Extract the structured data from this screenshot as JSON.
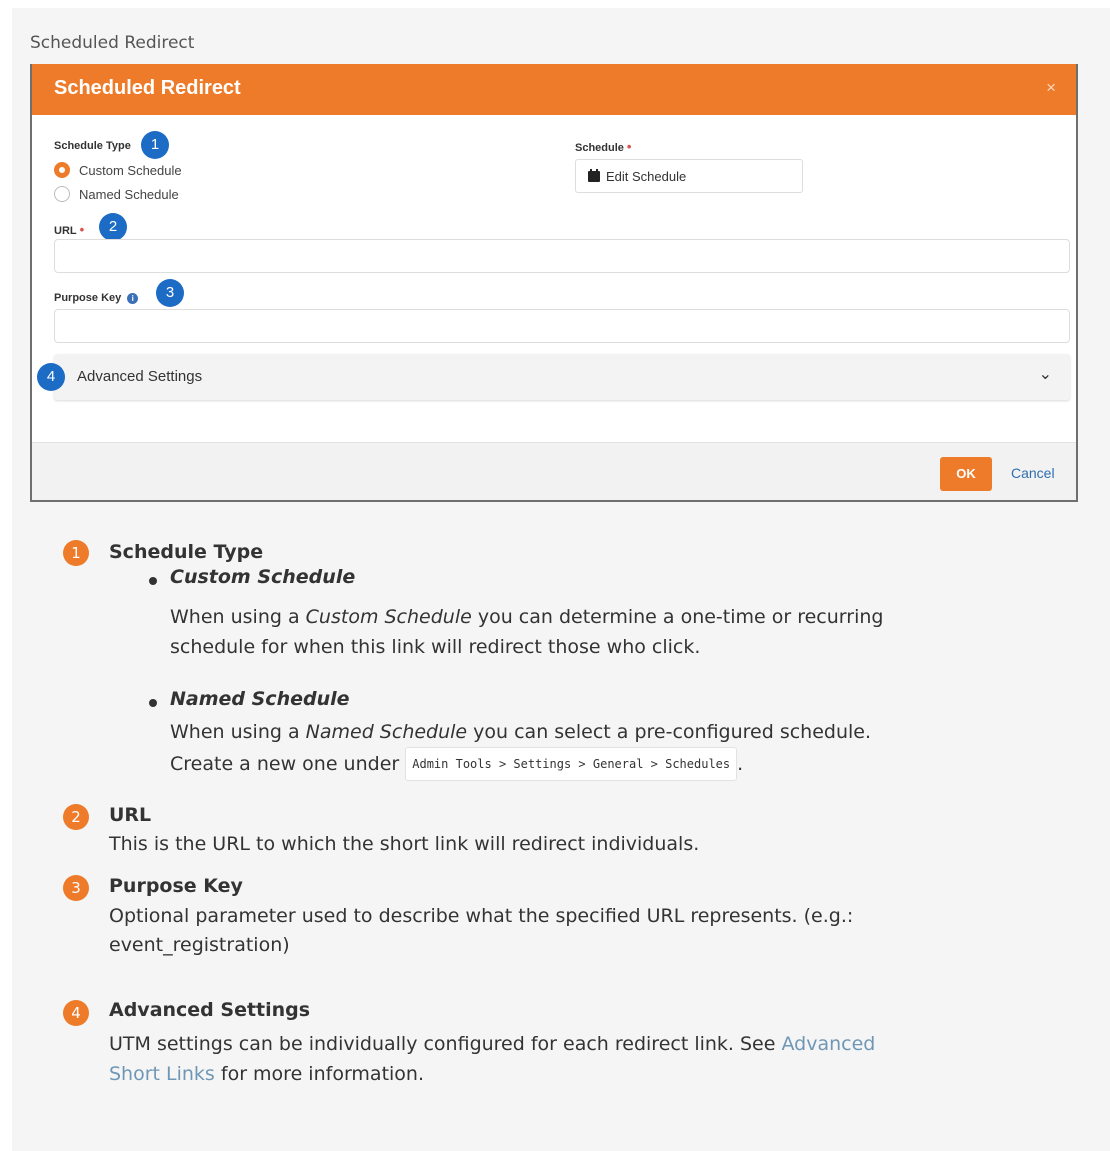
{
  "caption": "Scheduled Redirect",
  "modal": {
    "title": "Scheduled Redirect",
    "close_label": "×",
    "schedule_type": {
      "label": "Schedule Type",
      "callout": "1",
      "options": [
        {
          "label": "Custom Schedule",
          "checked": true
        },
        {
          "label": "Named Schedule",
          "checked": false
        }
      ]
    },
    "schedule": {
      "label": "Schedule",
      "required_mark": "•",
      "button_label": "Edit Schedule",
      "button_icon": "calendar-icon"
    },
    "url": {
      "label": "URL",
      "required_mark": "•",
      "callout": "2",
      "value": ""
    },
    "purpose_key": {
      "label": "Purpose Key",
      "info_icon": "info-icon",
      "info_glyph": "i",
      "callout": "3",
      "value": ""
    },
    "advanced": {
      "callout": "4",
      "label": "Advanced Settings",
      "chevron_icon": "chevron-down-icon",
      "chevron_glyph": "⌄"
    },
    "footer": {
      "ok_label": "OK",
      "cancel_label": "Cancel"
    }
  },
  "notes": [
    {
      "number": "1",
      "title": "Schedule Type",
      "bullets": [
        {
          "title": "Custom Schedule",
          "text_pre": "When using a ",
          "text_em": "Custom Schedule",
          "text_post": " you can determine a one-time or recurring",
          "text_line2": "schedule for when this link will redirect those who click."
        },
        {
          "title": "Named Schedule",
          "text_pre": "When using a ",
          "text_em": "Named Schedule",
          "text_post": " you can select a pre-configured schedule.",
          "text_line2_pre": "Create a new one under ",
          "code": "Admin Tools > Settings > General > Schedules",
          "text_line2_post": "."
        }
      ]
    },
    {
      "number": "2",
      "title": "URL",
      "text": "This is the URL to which the short link will redirect individuals."
    },
    {
      "number": "3",
      "title": "Purpose Key",
      "text_line1": "Optional parameter used to describe what the specified URL represents. (e.g.:",
      "text_line2": "event_registration)"
    },
    {
      "number": "4",
      "title": "Advanced Settings",
      "text_line1_pre": "UTM settings can be individually configured for each redirect link. See ",
      "link_part1": "Advanced",
      "link_part2": "Short Links",
      "text_line2_post": " for more information."
    }
  ],
  "colors": {
    "accent": "#ee7b2a",
    "callout_blue": "#1c6bc5",
    "link": "#6f97b5",
    "required": "#d9534f"
  }
}
